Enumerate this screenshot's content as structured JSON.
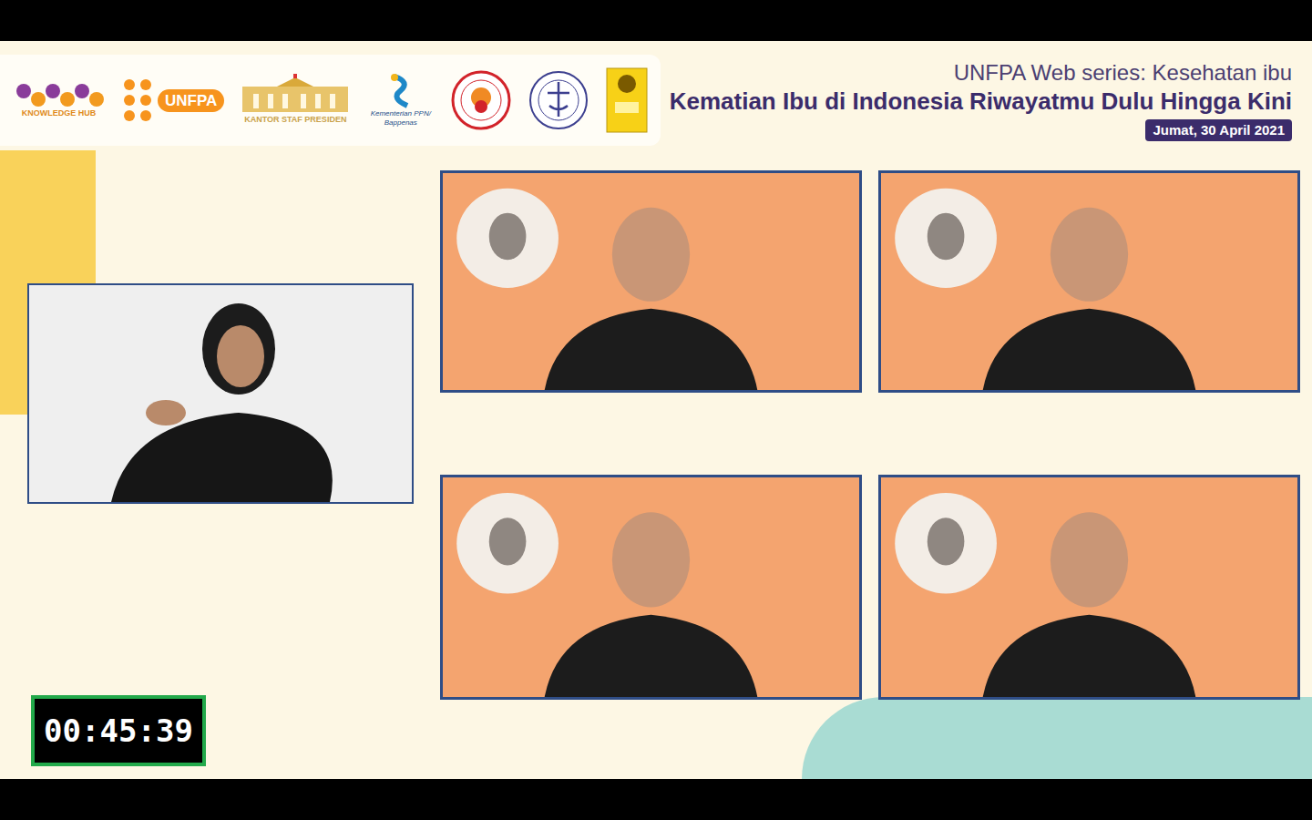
{
  "header": {
    "logos": [
      {
        "kind": "knowledge-hub",
        "label": "KNOWLEDGE HUB"
      },
      {
        "kind": "unfpa",
        "label": "UNFPA"
      },
      {
        "kind": "ksp",
        "label": "KANTOR STAF PRESIDEN"
      },
      {
        "kind": "bappenas",
        "label": "Kementerian PPN/ Bappenas"
      },
      {
        "kind": "seal-red"
      },
      {
        "kind": "seal-blue"
      },
      {
        "kind": "shield-yellow"
      }
    ],
    "series": "UNFPA Web series: Kesehatan ibu",
    "title": "Kematian Ibu di Indonesia Riwayatmu Dulu Hingga Kini",
    "date": "Jumat, 30 April 2021"
  },
  "participants": [
    {
      "kind": "interpreter"
    },
    {
      "kind": "speaker"
    },
    {
      "kind": "speaker"
    },
    {
      "kind": "speaker"
    },
    {
      "kind": "speaker"
    }
  ],
  "timer": "00:45:39"
}
